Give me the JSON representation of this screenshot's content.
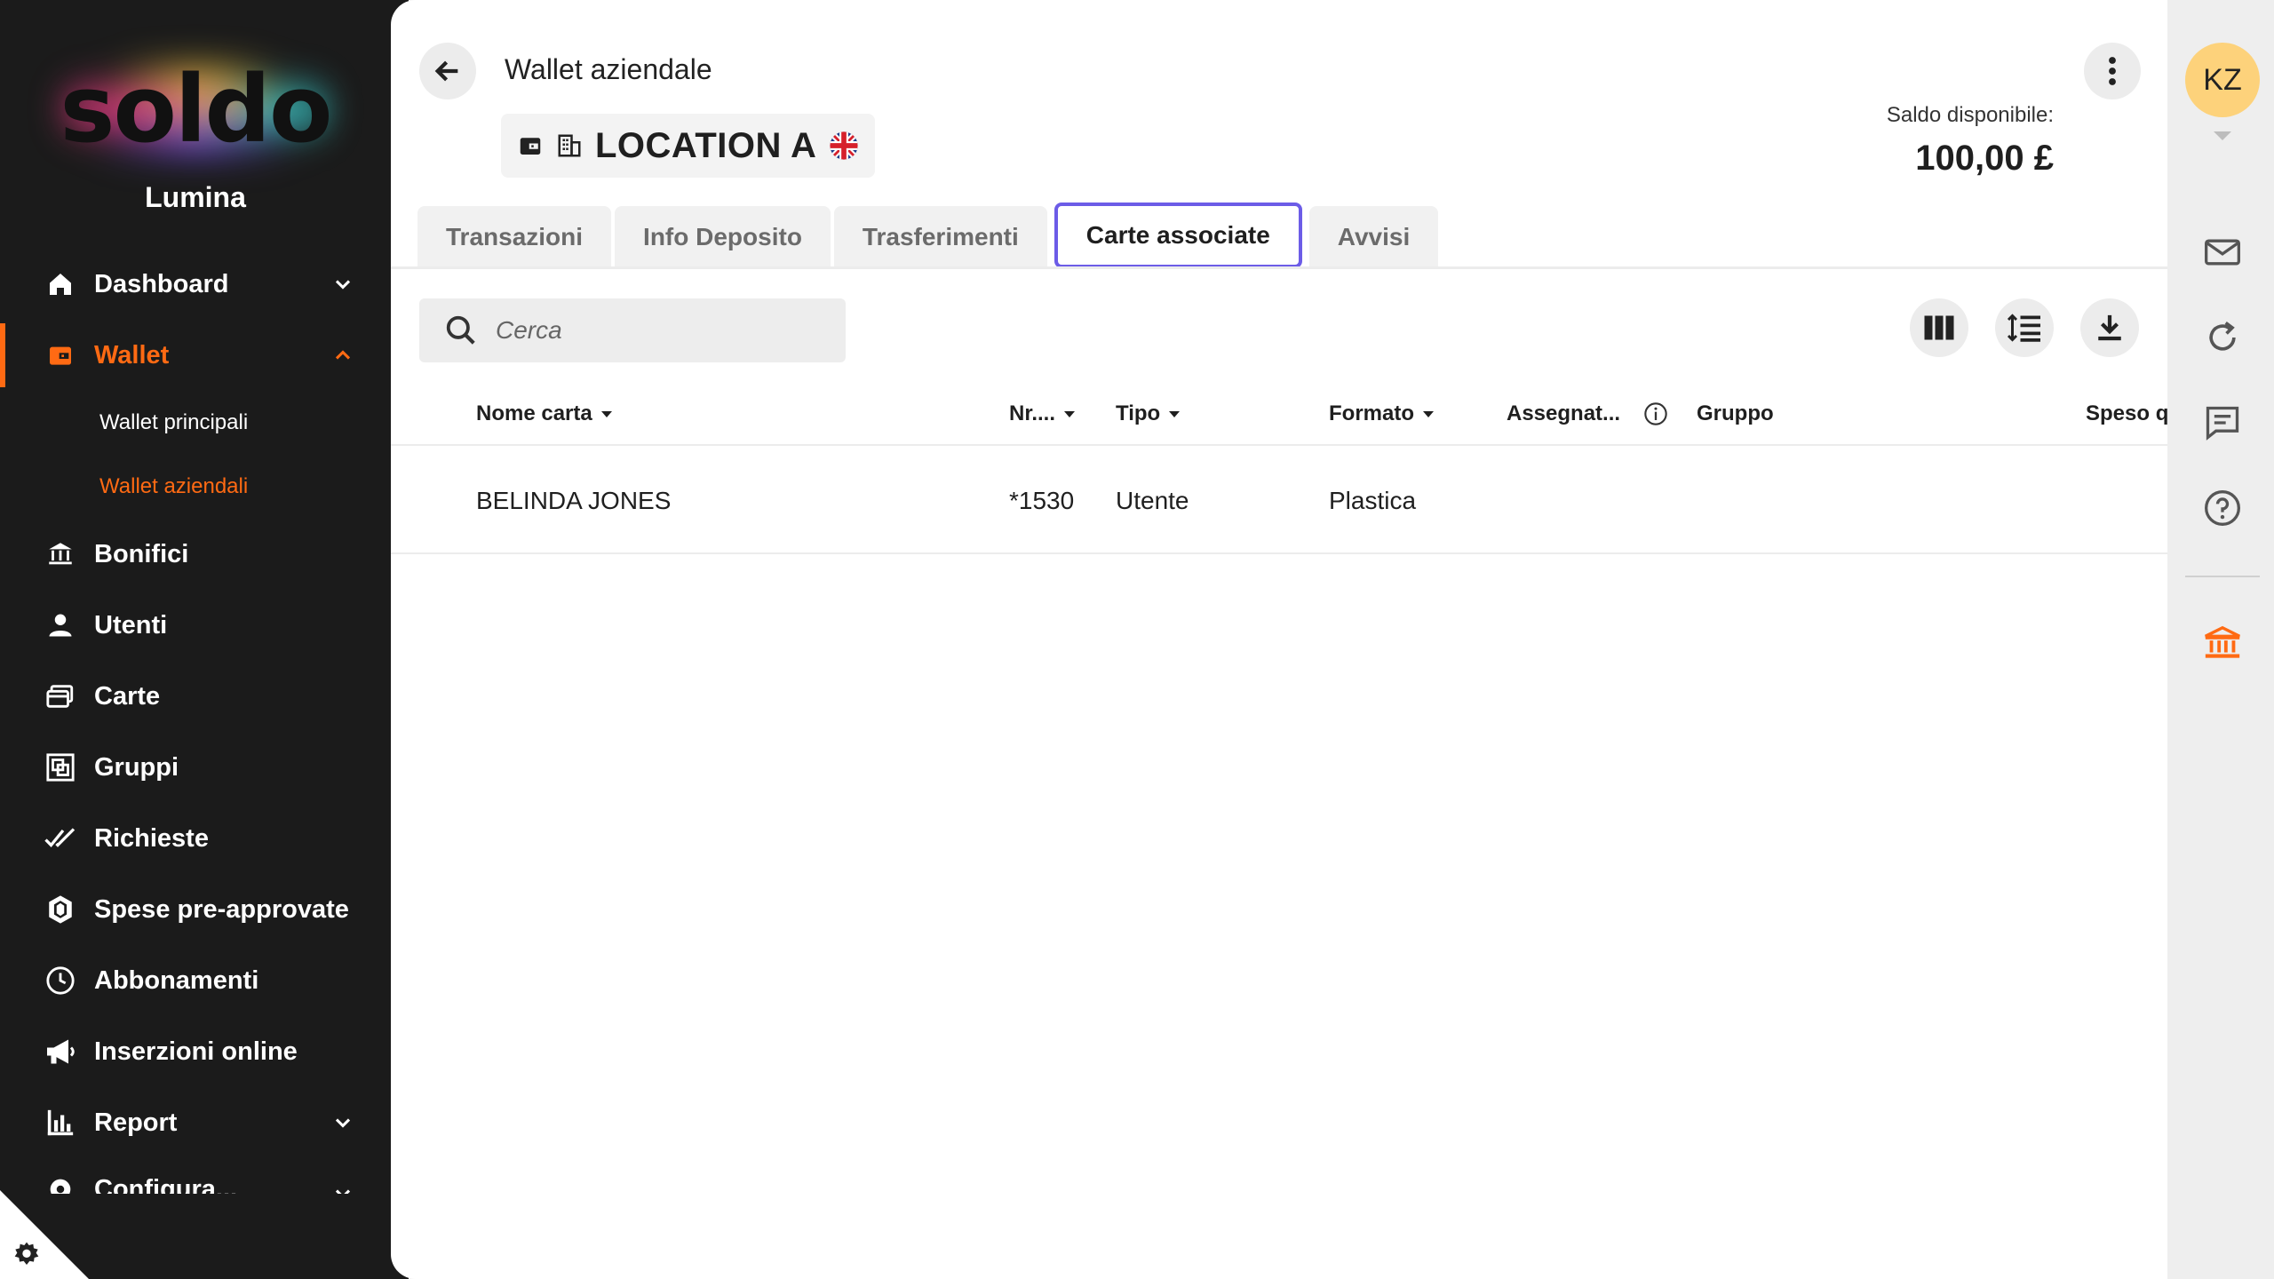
{
  "sidebar": {
    "brand": "soldo",
    "org": "Lumina",
    "items": [
      {
        "label": "Dashboard",
        "icon": "home-icon",
        "expandable": true
      },
      {
        "label": "Wallet",
        "icon": "wallet-icon",
        "expandable": true,
        "active": true,
        "subitems": [
          {
            "label": "Wallet principali"
          },
          {
            "label": "Wallet aziendali",
            "active": true
          }
        ]
      },
      {
        "label": "Bonifici",
        "icon": "bank-transfer-icon"
      },
      {
        "label": "Utenti",
        "icon": "user-icon"
      },
      {
        "label": "Carte",
        "icon": "cards-icon"
      },
      {
        "label": "Gruppi",
        "icon": "groups-icon"
      },
      {
        "label": "Richieste",
        "icon": "double-check-icon"
      },
      {
        "label": "Spese pre-approvate",
        "icon": "hexagon-shield-icon"
      },
      {
        "label": "Abbonamenti",
        "icon": "clock-icon"
      },
      {
        "label": "Inserzioni online",
        "icon": "megaphone-icon"
      },
      {
        "label": "Report",
        "icon": "bar-chart-icon",
        "expandable": true
      },
      {
        "label": "Configura...",
        "icon": "cog-icon",
        "expandable": true
      }
    ]
  },
  "header": {
    "title": "Wallet aziendale",
    "location": "LOCATION A",
    "balance_label": "Saldo disponibile:",
    "balance_value": "100,00 £"
  },
  "tabs": [
    {
      "label": "Transazioni"
    },
    {
      "label": "Info Deposito"
    },
    {
      "label": "Trasferimenti"
    },
    {
      "label": "Carte associate",
      "active": true
    },
    {
      "label": "Avvisi"
    }
  ],
  "search": {
    "placeholder": "Cerca",
    "value": ""
  },
  "table": {
    "columns": [
      {
        "label": "Nome carta",
        "sortable": true
      },
      {
        "label": "Nr....",
        "sortable": true
      },
      {
        "label": "Tipo",
        "sortable": true
      },
      {
        "label": "Formato",
        "sortable": true
      },
      {
        "label": "Assegnat...",
        "info": true
      },
      {
        "label": "Gruppo"
      },
      {
        "label": "Speso q"
      }
    ],
    "rows": [
      {
        "name": "BELINDA JONES",
        "number": "*1530",
        "type": "Utente",
        "format": "Plastica"
      }
    ]
  },
  "user": {
    "initials": "KZ"
  },
  "colors": {
    "accent": "#ff6a13",
    "tab_focus": "#6c5ce7",
    "sidebar_bg": "#1b1b1b",
    "avatar_bg": "#fdd27b"
  }
}
